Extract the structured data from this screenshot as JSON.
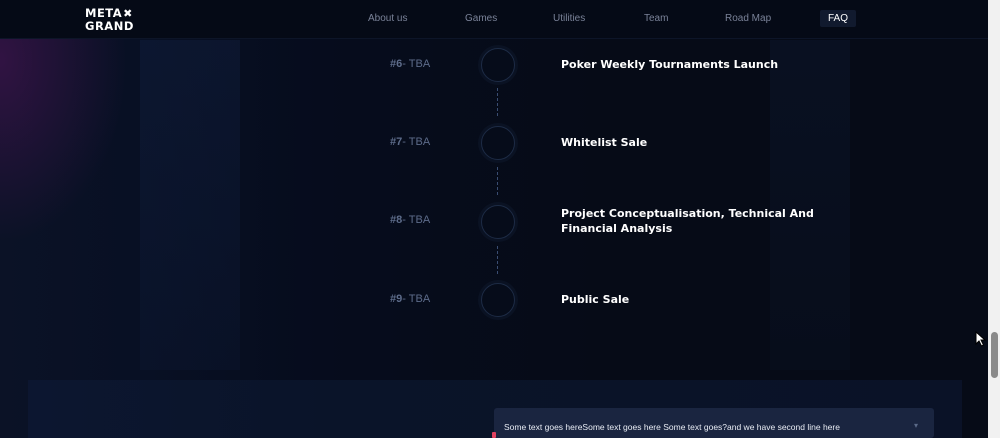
{
  "header": {
    "logo_line1": "META",
    "logo_line2": "GRAND",
    "nav": [
      {
        "label": "About us"
      },
      {
        "label": "Games"
      },
      {
        "label": "Utilities"
      },
      {
        "label": "Team"
      },
      {
        "label": "Road Map"
      },
      {
        "label": "FAQ",
        "active": true
      }
    ]
  },
  "roadmap": {
    "items": [
      {
        "number": "#6",
        "status": "TBA",
        "title": "Poker Weekly Tournaments Launch"
      },
      {
        "number": "#7",
        "status": "TBA",
        "title": "Whitelist Sale"
      },
      {
        "number": "#8",
        "status": "TBA",
        "title": "Project Conceptualisation, Technical And Financial Analysis"
      },
      {
        "number": "#9",
        "status": "TBA",
        "title": "Public Sale"
      }
    ],
    "separator": "- "
  },
  "faq": {
    "message_text": "Some text goes hereSome text goes here Some text goes?and we have second line here"
  },
  "colors": {
    "background": "#060b17",
    "accent": "#e0415f",
    "muted_text": "#5d6c8a"
  },
  "icons": {
    "logo_mark": "x-mark",
    "chevron": "chevron-down-icon",
    "cursor": "mouse-pointer-icon"
  }
}
